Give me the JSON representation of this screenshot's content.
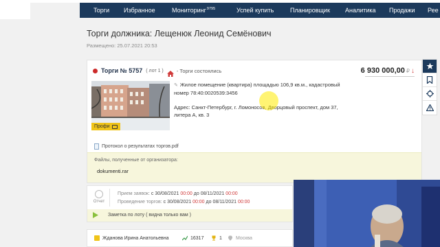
{
  "nav": {
    "items": [
      "Торги",
      "Избранное",
      "Мониторинг",
      "Успей купить",
      "Планировщик",
      "Аналитика",
      "Продажи",
      "Рее"
    ],
    "monitoring_badge": "9795"
  },
  "page": {
    "title": "Торги должника: Лещенюк Леонид Семёнович",
    "posted": "Размещено: 25.07.2021 20:53"
  },
  "lot": {
    "number": "Торги № 5757",
    "tag": "( лот 1 )",
    "status": "- Торги состоялись",
    "price": "6 930 000,00",
    "currency": "₽",
    "price_trend_icon": "arrow-down-icon",
    "description": "Жилое помещение (квартира) площадью 106,9 кв.м., кадастровый номер 78:40:0020539:3456",
    "address": "Адрес: Санкт-Петербург, г. Ломоносов, Дворцовый проспект, дом 37, литера А, кв. 3",
    "badge": "Профи",
    "protocol": "Протокол о результатах торгов.pdf",
    "files_label": "Файлы, полученные от организатора:",
    "file_name": "dokumenti.rar"
  },
  "schedule": {
    "report_label": "Отчет",
    "applications_label": "Прием заявок:",
    "applications_from": "с 30/08/2021",
    "applications_from_time": "00:00",
    "applications_to": "до 08/11/2021",
    "applications_to_time": "00:00",
    "auction_label": "Проведение торгов:",
    "auction_from": "с 30/08/2021",
    "auction_from_time": "00:00",
    "auction_to": "до 08/11/2021",
    "auction_to_time": "00:00",
    "note": "Заметка по лоту ( видна только вам )"
  },
  "manager": {
    "name": "Жданова Ирина Анатольевна",
    "count": "16317",
    "rank": "1",
    "city": "Москва"
  },
  "colors": {
    "nav_bg": "#1c3a5c",
    "accent_red": "#d03a3a",
    "note_bg": "#f7f6dc"
  }
}
